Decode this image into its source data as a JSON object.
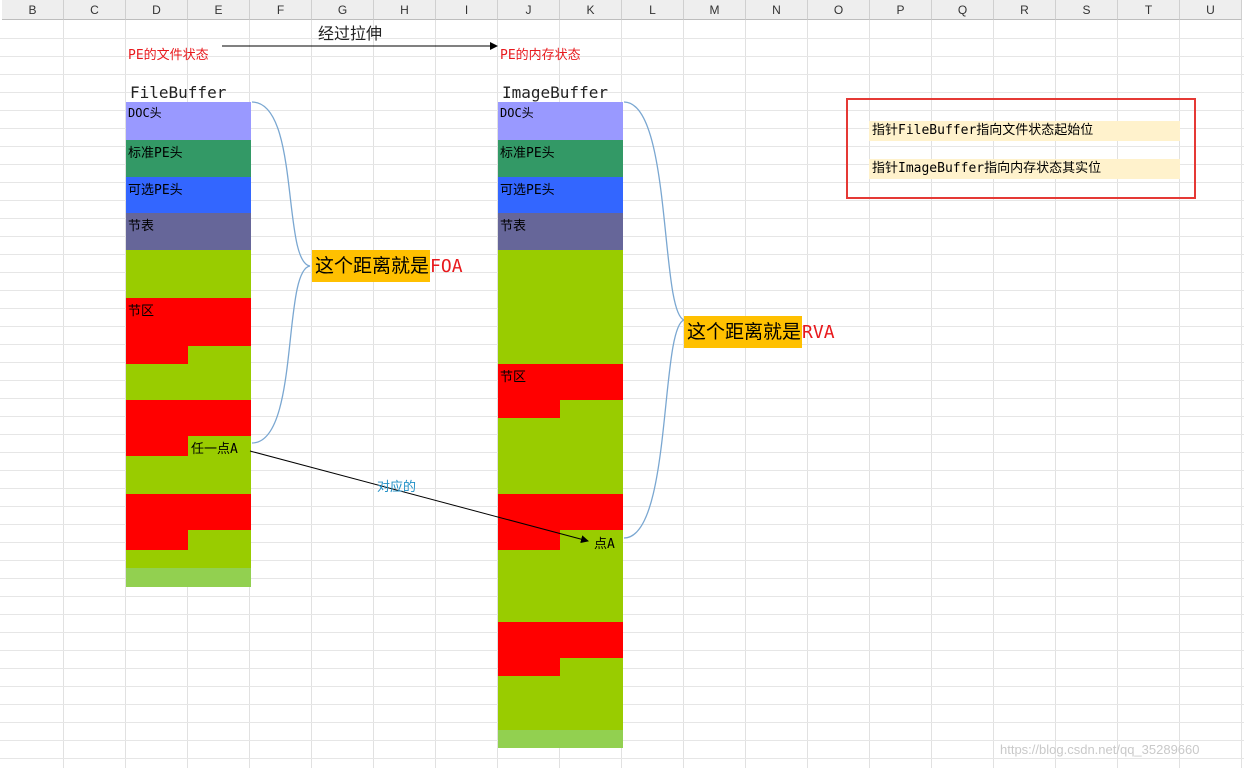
{
  "columns": [
    "B",
    "C",
    "D",
    "E",
    "F",
    "G",
    "H",
    "I",
    "J",
    "K",
    "L",
    "M",
    "N",
    "O",
    "P",
    "Q",
    "R",
    "S",
    "T",
    "U"
  ],
  "colors": {
    "doc": "#9999ff",
    "std_pe": "#339966",
    "opt_pe": "#3366ff",
    "section_table": "#666699",
    "green": "#99cc00",
    "red": "#ff0000",
    "light_green": "#92d050",
    "note_bg": "#fff2cc",
    "note_border": "#e53935",
    "callout_bg": "#ffc000",
    "curve": "#7aa7d1",
    "arrow": "#000000",
    "mapping_text": "#1f8fc6"
  },
  "header": {
    "file_state": "PE的文件状态",
    "stretch": "经过拉伸",
    "mem_state": "PE的内存状态"
  },
  "file_buffer": {
    "title": "FileBuffer",
    "doc": "DOC头",
    "std_pe": "标准PE头",
    "opt_pe": "可选PE头",
    "section_table": "节表",
    "section": "节区",
    "point": "任一点A"
  },
  "image_buffer": {
    "title": "ImageBuffer",
    "doc": "DOC头",
    "std_pe": "标准PE头",
    "opt_pe": "可选PE头",
    "section_table": "节表",
    "section": "节区",
    "point": "点A"
  },
  "callouts": {
    "foa_text": "这个距离就是",
    "foa_abbr": "FOA",
    "rva_text": "这个距离就是",
    "rva_abbr": "RVA"
  },
  "mapping_label": "对应的",
  "notes": {
    "line1": "指针FileBuffer指向文件状态起始位",
    "line2": "指针ImageBuffer指向内存状态其实位"
  },
  "watermark": "https://blog.csdn.net/qq_35289660"
}
